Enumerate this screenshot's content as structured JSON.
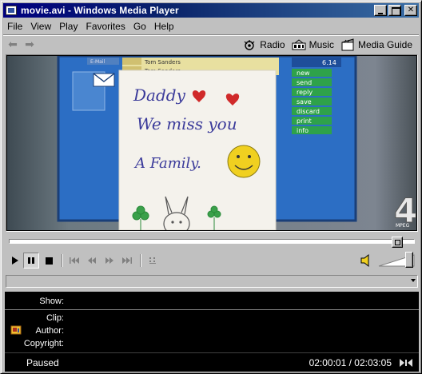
{
  "window": {
    "title": "movie.avi - Windows Media Player",
    "icon": "media-player-icon"
  },
  "menu": {
    "items": [
      {
        "label": "File"
      },
      {
        "label": "View"
      },
      {
        "label": "Play"
      },
      {
        "label": "Favorites"
      },
      {
        "label": "Go"
      },
      {
        "label": "Help"
      }
    ]
  },
  "nav": {
    "back_icon": "back-arrow-icon",
    "forward_icon": "forward-arrow-icon",
    "links": [
      {
        "label": "Radio",
        "icon": "radio-icon"
      },
      {
        "label": "Music",
        "icon": "music-icon"
      },
      {
        "label": "Media Guide",
        "icon": "media-guide-icon"
      }
    ]
  },
  "video": {
    "handwriting": [
      "Daddy",
      "We miss you",
      "A Family."
    ],
    "email_header": {
      "from": "Tom Sanders",
      "to": "Tom Sanders",
      "file": "E-Mail"
    },
    "menu_tag": "6.14",
    "menu_items": [
      "new",
      "send",
      "reply",
      "save",
      "discard",
      "print",
      "info"
    ],
    "watermark": "4",
    "watermark_sub": "MPEG"
  },
  "playback": {
    "position_fraction": 0.97,
    "volume_fraction": 0.95,
    "state": "Paused"
  },
  "info": {
    "show_label": "Show:",
    "show_value": "",
    "clip_label": "Clip:",
    "clip_value": "",
    "author_label": "Author:",
    "author_value": "",
    "copyright_label": "Copyright:",
    "copyright_value": ""
  },
  "status": {
    "state": "Paused",
    "time": "02:00:01 / 02:03:05"
  }
}
